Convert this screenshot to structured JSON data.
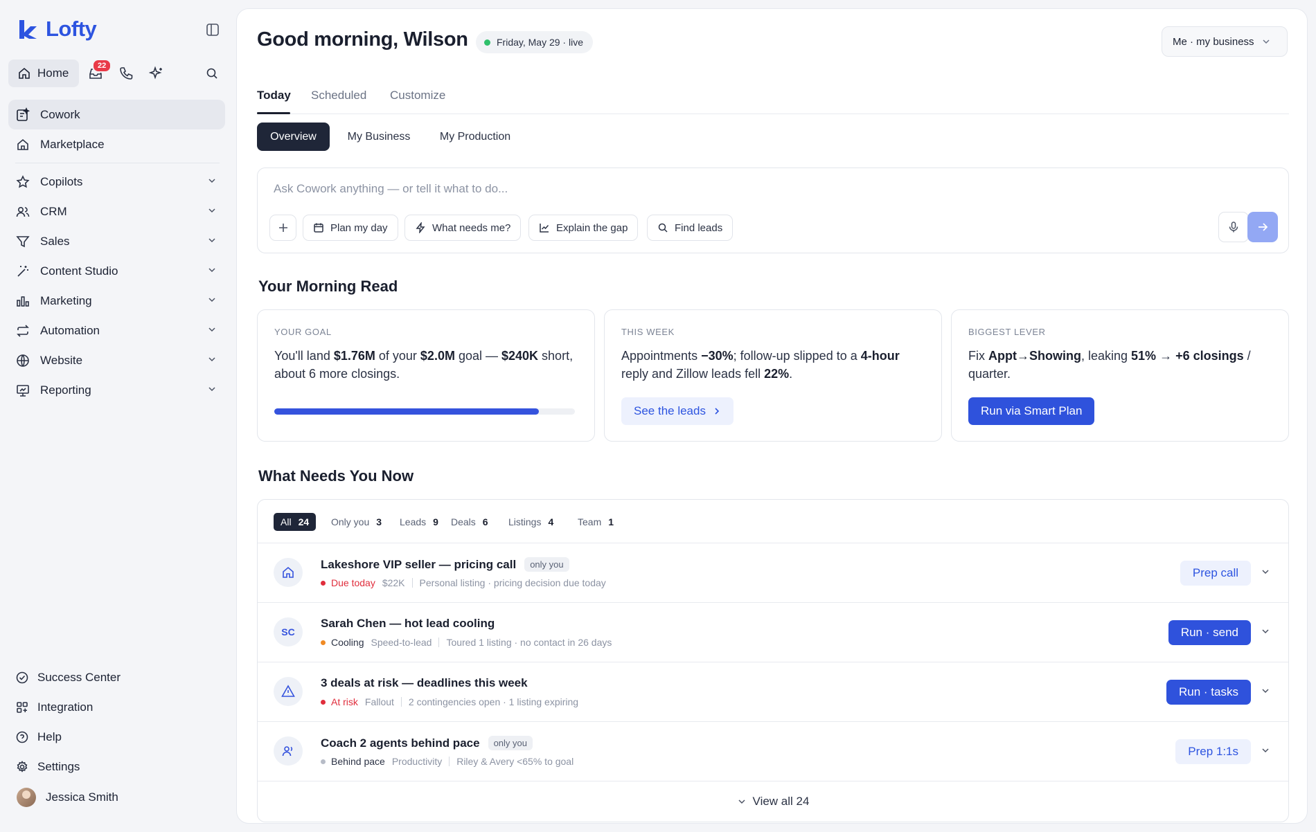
{
  "brand": {
    "name": "Lofty",
    "accent": "#2d54e0"
  },
  "topnav": {
    "home_label": "Home",
    "inbox_badge": "22"
  },
  "sidebar": {
    "primary": [
      {
        "label": "Cowork",
        "icon": "cowork-icon",
        "active": true
      },
      {
        "label": "Marketplace",
        "icon": "store-icon"
      }
    ],
    "groups": [
      {
        "label": "Copilots",
        "icon": "star-icon"
      },
      {
        "label": "CRM",
        "icon": "users-icon"
      },
      {
        "label": "Sales",
        "icon": "filter-icon"
      },
      {
        "label": "Content Studio",
        "icon": "magic-wand-icon"
      },
      {
        "label": "Marketing",
        "icon": "bar-chart-icon"
      },
      {
        "label": "Automation",
        "icon": "repeat-icon"
      },
      {
        "label": "Website",
        "icon": "globe-icon"
      },
      {
        "label": "Reporting",
        "icon": "presentation-icon"
      }
    ],
    "footer": [
      {
        "label": "Success Center",
        "icon": "check-circle-icon"
      },
      {
        "label": "Integration",
        "icon": "grid-plus-icon"
      },
      {
        "label": "Help",
        "icon": "help-circle-icon"
      },
      {
        "label": "Settings",
        "icon": "gear-icon"
      }
    ],
    "user": {
      "name": "Jessica Smith"
    }
  },
  "header": {
    "greeting": "Good morning, Wilson",
    "date_status": "Friday, May 29 · live",
    "scope_select": "Me · my business"
  },
  "tabs": [
    "Today",
    "Scheduled",
    "Customize"
  ],
  "segments": [
    "Overview",
    "My Business",
    "My Production"
  ],
  "ask": {
    "placeholder": "Ask Cowork anything — or tell it what to do...",
    "chips": [
      "Plan my day",
      "What needs me?",
      "Explain the gap",
      "Find leads"
    ]
  },
  "morning_read": {
    "title": "Your Morning Read",
    "goal": {
      "label": "YOUR GOAL",
      "t1": "You'll land ",
      "b1": "$1.76M",
      "t2": " of your ",
      "b2": "$2.0M",
      "t3": " goal — ",
      "b3": "$240K",
      "t4": " short, about 6 more closings.",
      "progress": 0.88
    },
    "week": {
      "label": "THIS WEEK",
      "t1": "Appointments ",
      "b1": "−30%",
      "t2": "; follow-up slipped to a ",
      "b2": "4-hour",
      "t3": " reply and Zillow leads fell ",
      "b3": "22%",
      "t4": ".",
      "button": "See the leads"
    },
    "lever": {
      "label": "BIGGEST LEVER",
      "t1": "Fix ",
      "b1": "Appt→Showing",
      "t2": ", leaking ",
      "b2": "51%",
      "t3": " → ",
      "b3": "+6 closings",
      "t4": " / quarter.",
      "button": "Run via Smart Plan"
    }
  },
  "needs": {
    "title": "What Needs You Now",
    "filters": [
      {
        "label": "All",
        "count": "24"
      },
      {
        "label": "Only you",
        "count": "3"
      },
      {
        "label": "Leads",
        "count": "9"
      },
      {
        "label": "Deals",
        "count": "6"
      },
      {
        "label": "Listings",
        "count": "4"
      },
      {
        "label": "Team",
        "count": "1"
      }
    ],
    "rows": [
      {
        "icon": "home-icon",
        "initials": "",
        "title": "Lakeshore VIP seller — pricing call",
        "tag": "only you",
        "status": "Due today",
        "status_color": "#e02d3c",
        "category": "$22K",
        "detail": "Personal listing · pricing decision due today",
        "action": "Prep call"
      },
      {
        "icon": "avatar-initials",
        "initials": "SC",
        "title": "Sarah Chen — hot lead cooling",
        "tag": "",
        "status": "Cooling",
        "status_color": "#f08a24",
        "category": "Speed-to-lead",
        "detail": "Toured 1 listing · no contact in 26 days",
        "action": "Run · send"
      },
      {
        "icon": "warning-icon",
        "initials": "",
        "title": "3 deals at risk — deadlines this week",
        "tag": "",
        "status": "At risk",
        "status_color": "#e02d3c",
        "category": "Fallout",
        "detail": "2 contingencies open · 1 listing expiring",
        "action": "Run · tasks"
      },
      {
        "icon": "coach-icon",
        "initials": "",
        "title": "Coach 2 agents behind pace",
        "tag": "only you",
        "status": "Behind pace",
        "status_color": "#b7bcc7",
        "category": "Productivity",
        "detail": "Riley & Avery <65% to goal",
        "action": "Prep 1:1s"
      }
    ],
    "view_all": "View all 24"
  }
}
